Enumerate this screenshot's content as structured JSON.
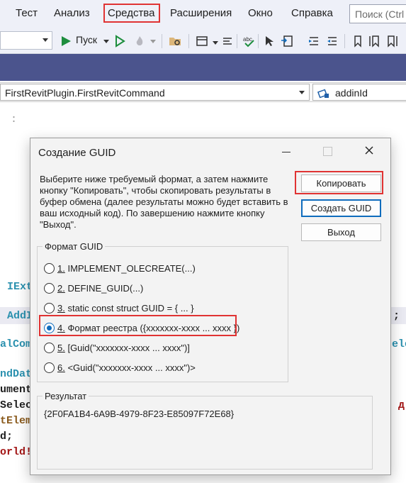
{
  "menubar": {
    "items": [
      "Тест",
      "Анализ",
      "Средства",
      "Расширения",
      "Окно",
      "Справка"
    ],
    "search_placeholder": "Поиск (Ctrl"
  },
  "toolbar": {
    "run_label": "Пуск"
  },
  "navbar": {
    "left_value": "FirstRevitPlugin.FirstRevitCommand",
    "right_value": "addinId"
  },
  "editor": {
    "lines": [
      "IExt",
      "AddI",
      ";",
      "alCom",
      "ele",
      "ndDat",
      "ument",
      "Selec",
      "д",
      "tElem",
      "d;",
      "orld!"
    ]
  },
  "dialog": {
    "title": "Создание GUID",
    "description": "Выберите ниже требуемый формат, а затем нажмите кнопку \"Копировать\", чтобы скопировать результаты в буфер обмена (далее результаты можно будет вставить в ваш исходный код).  По завершению нажмите кнопку \"Выход\".",
    "buttons": {
      "copy": "Копировать",
      "create": "Создать GUID",
      "exit": "Выход"
    },
    "format_group": {
      "label": "Формат GUID",
      "options": [
        {
          "num": "1.",
          "text": " IMPLEMENT_OLECREATE(...)"
        },
        {
          "num": "2.",
          "text": " DEFINE_GUID(...)"
        },
        {
          "num": "3.",
          "text": " static const struct GUID = { ... }"
        },
        {
          "num": "4.",
          "text": " Формат реестра ({xxxxxxx-xxxx ... xxxx })"
        },
        {
          "num": "5.",
          "text": " [Guid(\"xxxxxxx-xxxx ... xxxx\")]"
        },
        {
          "num": "6.",
          "text": " <Guid(\"xxxxxxx-xxxx ... xxxx\")>"
        }
      ],
      "selected_index": 3
    },
    "result_group": {
      "label": "Результат",
      "value": "{2F0FA1B4-6A9B-4979-8F23-E85097F72E68}"
    }
  },
  "colors": {
    "accent": "#0f6cbd",
    "highlight": "#e03333",
    "title_strip": "#4b548d"
  }
}
